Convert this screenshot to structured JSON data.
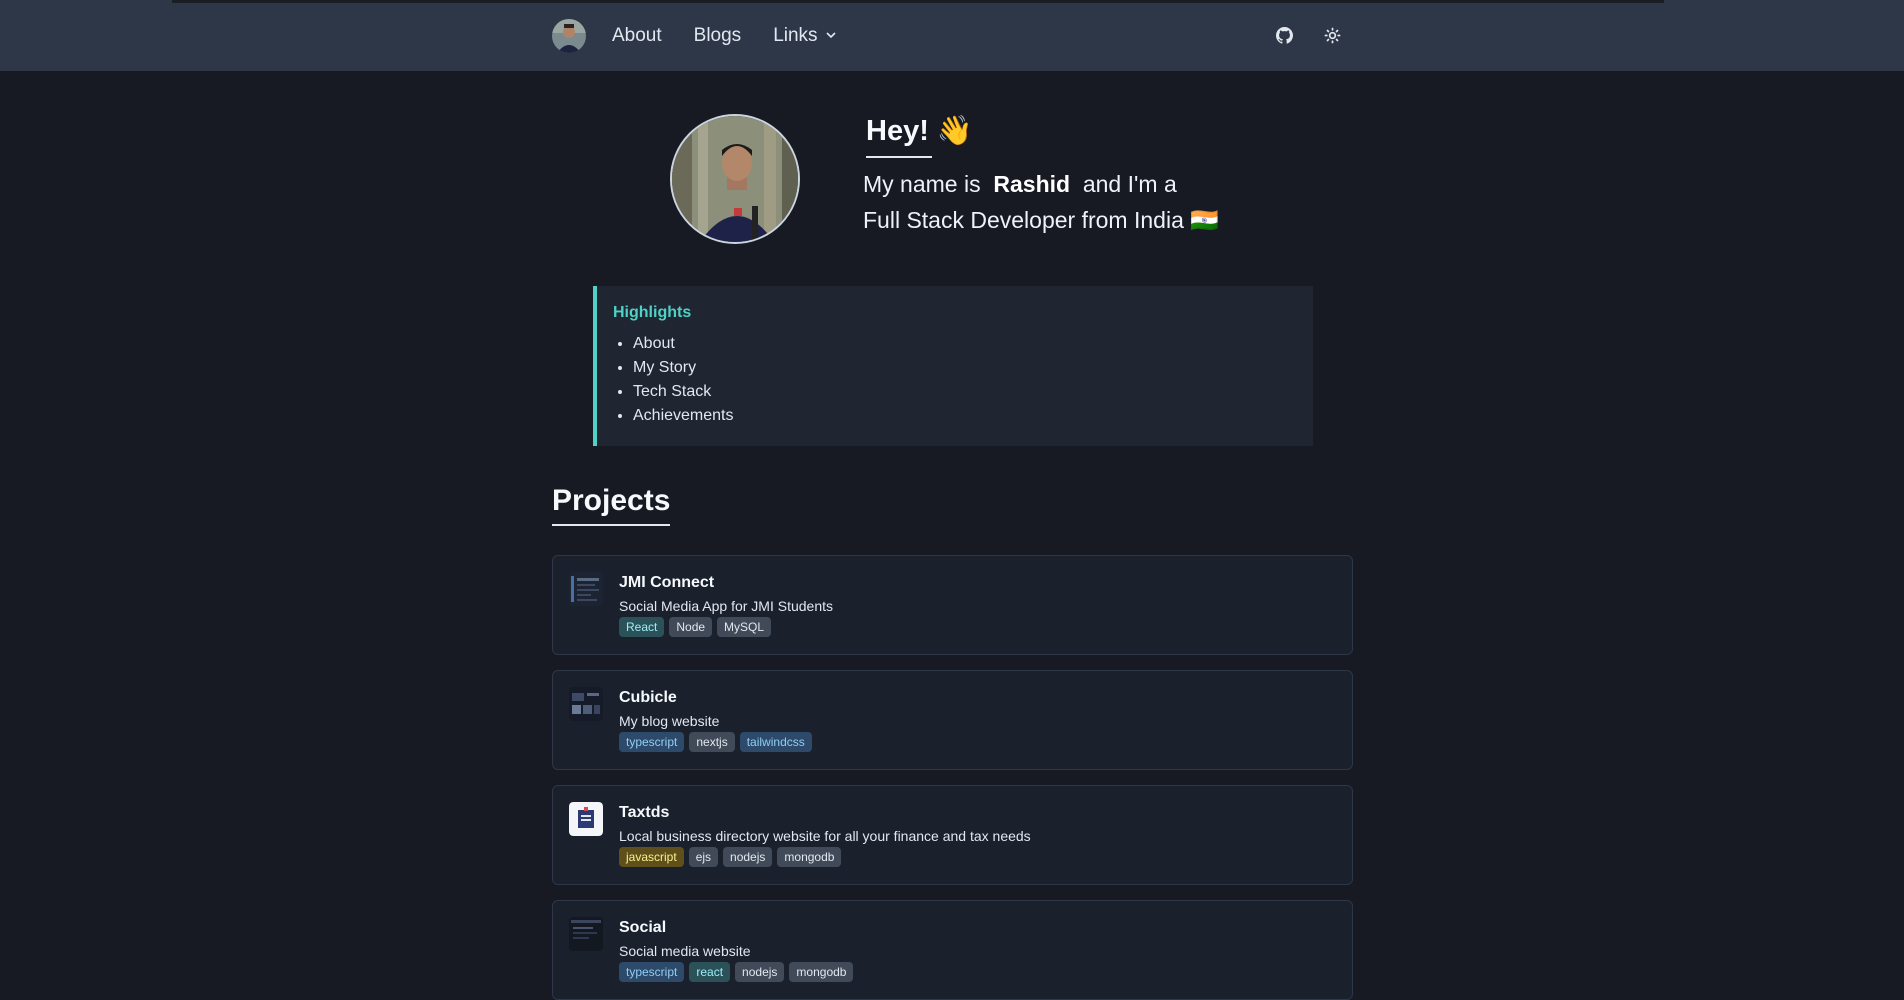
{
  "nav": {
    "links": [
      {
        "label": "About"
      },
      {
        "label": "Blogs"
      },
      {
        "label": "Links"
      }
    ],
    "icons": [
      "avatar",
      "github-icon",
      "sun-icon",
      "chevron-down-icon"
    ]
  },
  "hero": {
    "greeting": "Hey! 👋",
    "intro_prefix": "My name is",
    "name": "Rashid",
    "intro_suffix": "and I'm a",
    "line2": "Full Stack Developer from India 🇮🇳"
  },
  "highlights": {
    "title": "Highlights",
    "items": [
      "About",
      "My Story",
      "Tech Stack",
      "Achievements"
    ]
  },
  "projects": {
    "title": "Projects",
    "items": [
      {
        "name": "JMI Connect",
        "description": "Social Media App for JMI Students",
        "tags": [
          {
            "label": "React",
            "style": "teal"
          },
          {
            "label": "Node",
            "style": "gray"
          },
          {
            "label": "MySQL",
            "style": "gray"
          }
        ]
      },
      {
        "name": "Cubicle",
        "description": "My blog website",
        "tags": [
          {
            "label": "typescript",
            "style": "blue"
          },
          {
            "label": "nextjs",
            "style": "gray"
          },
          {
            "label": "tailwindcss",
            "style": "blue"
          }
        ]
      },
      {
        "name": "Taxtds",
        "description": "Local business directory website for all your finance and tax needs",
        "tags": [
          {
            "label": "javascript",
            "style": "yellow"
          },
          {
            "label": "ejs",
            "style": "gray"
          },
          {
            "label": "nodejs",
            "style": "gray"
          },
          {
            "label": "mongodb",
            "style": "gray"
          }
        ]
      },
      {
        "name": "Social",
        "description": "Social media website",
        "tags": [
          {
            "label": "typescript",
            "style": "blue"
          },
          {
            "label": "react",
            "style": "teal"
          },
          {
            "label": "nodejs",
            "style": "gray"
          },
          {
            "label": "mongodb",
            "style": "gray"
          }
        ]
      }
    ]
  },
  "colors": {
    "background": "#171923",
    "navbar": "#2d3748",
    "accent": "#4fd1c5"
  }
}
